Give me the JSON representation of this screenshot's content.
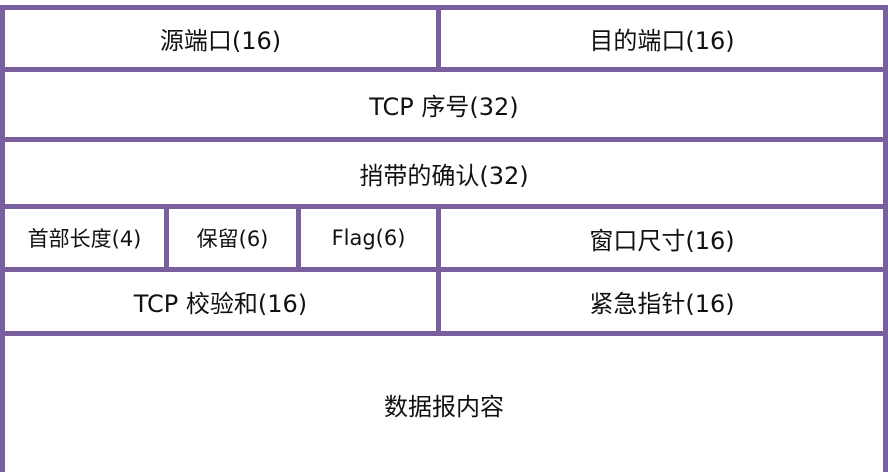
{
  "diagram": {
    "row1": {
      "source_port": "源端口(16)",
      "dest_port": "目的端口(16)"
    },
    "row2": {
      "sequence": "TCP 序号(32)"
    },
    "row3": {
      "ack": "捎带的确认(32)"
    },
    "row4": {
      "header_length": "首部长度(4)",
      "reserved": "保留(6)",
      "flag": "Flag(6)",
      "window": "窗口尺寸(16)"
    },
    "row5": {
      "checksum": "TCP 校验和(16)",
      "urgent": "紧急指针(16)"
    },
    "row6": {
      "payload": "数据报内容"
    },
    "border_color": "#7a5f9e"
  }
}
